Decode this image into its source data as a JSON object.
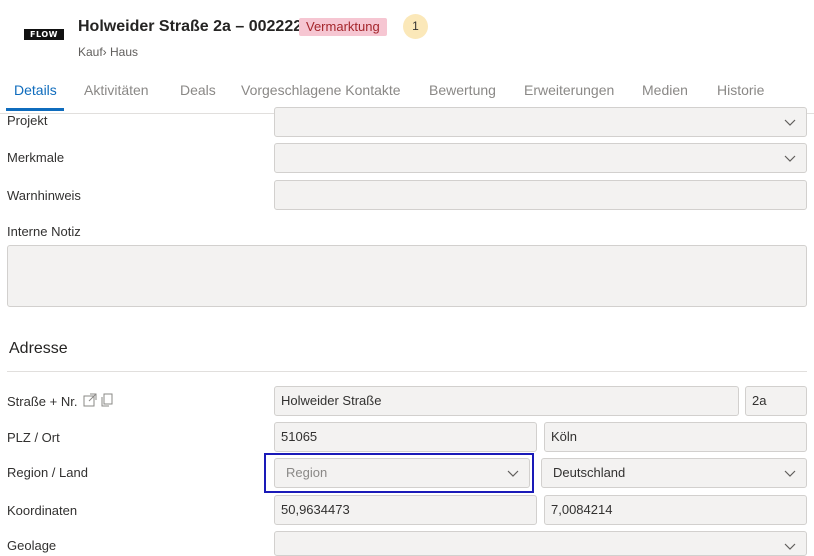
{
  "header": {
    "logo": "FLOW",
    "title": "Holweider Straße 2a – 002222",
    "badge": "Vermarktung",
    "counter": "1",
    "subtitle": "Kauf› Haus"
  },
  "tabs": [
    "Details",
    "Aktivitäten",
    "Deals",
    "Vorgeschlagene Kontakte",
    "Bewertung",
    "Erweiterungen",
    "Medien",
    "Historie"
  ],
  "fields": {
    "projekt": {
      "label": "Projekt",
      "value": ""
    },
    "merkmale": {
      "label": "Merkmale",
      "value": ""
    },
    "warnhinweis": {
      "label": "Warnhinweis",
      "value": ""
    },
    "interne_notiz": {
      "label": "Interne Notiz",
      "value": ""
    }
  },
  "adresse": {
    "heading": "Adresse",
    "strasse_label": "Straße + Nr.",
    "strasse": "Holweider Straße",
    "nr": "2a",
    "plz_label": "PLZ / Ort",
    "plz": "51065",
    "ort": "Köln",
    "region_label": "Region / Land",
    "region_placeholder": "Region",
    "land": "Deutschland",
    "koordinaten_label": "Koordinaten",
    "lat": "50,9634473",
    "lng": "7,0084214",
    "geolage_label": "Geolage"
  }
}
